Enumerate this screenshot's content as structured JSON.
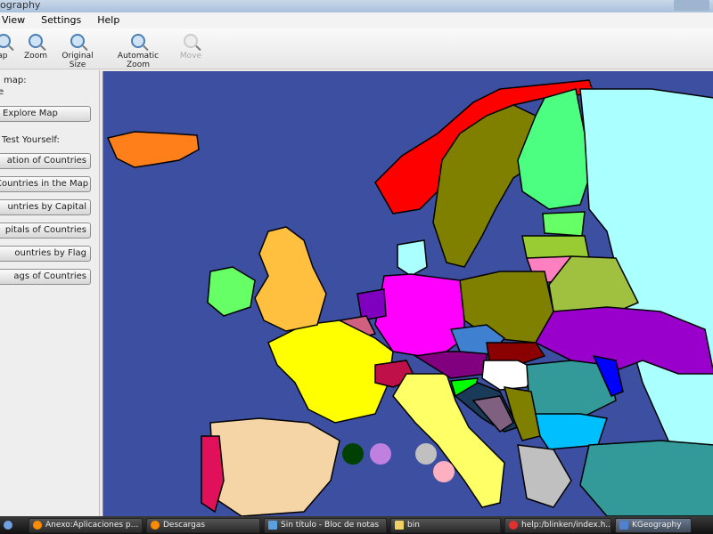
{
  "window": {
    "title": "ography"
  },
  "menu": {
    "items": [
      "View",
      "Settings",
      "Help"
    ]
  },
  "toolbar": {
    "items": [
      {
        "label": "Map",
        "icon": "map-icon"
      },
      {
        "label": "Zoom",
        "icon": "zoom-in-icon"
      },
      {
        "label": "Original Size",
        "icon": "zoom-original-icon"
      },
      {
        "label": "Automatic Zoom",
        "icon": "zoom-fit-icon"
      },
      {
        "label": "Move",
        "icon": "move-icon",
        "disabled": true
      }
    ]
  },
  "sidebar": {
    "map_label": "map:",
    "map_name": "e",
    "explore_button": "Explore Map",
    "test_label": "Test Yourself:",
    "tests": [
      "ation of Countries",
      "Countries in the Map",
      "untries by Capital",
      "pitals of Countries",
      "ountries by Flag",
      "ags of Countries"
    ]
  },
  "map": {
    "background": "#3d4fa0",
    "countries": [
      {
        "name": "iceland",
        "color": "#ff7f1a"
      },
      {
        "name": "norway",
        "color": "#ff0000"
      },
      {
        "name": "sweden",
        "color": "#808000"
      },
      {
        "name": "finland",
        "color": "#4cff80"
      },
      {
        "name": "russia",
        "color": "#aaffff"
      },
      {
        "name": "estonia",
        "color": "#66ff66"
      },
      {
        "name": "latvia",
        "color": "#99cc33"
      },
      {
        "name": "lithuania",
        "color": "#a0b040"
      },
      {
        "name": "kaliningrad",
        "color": "#ff80c0"
      },
      {
        "name": "belarus",
        "color": "#a0c040"
      },
      {
        "name": "ukraine",
        "color": "#9900cc"
      },
      {
        "name": "poland",
        "color": "#808000"
      },
      {
        "name": "germany",
        "color": "#ff00ff"
      },
      {
        "name": "denmark",
        "color": "#aaffff"
      },
      {
        "name": "netherlands",
        "color": "#8000c0"
      },
      {
        "name": "belgium",
        "color": "#d06080"
      },
      {
        "name": "france",
        "color": "#ffff00"
      },
      {
        "name": "uk",
        "color": "#ffc040"
      },
      {
        "name": "ireland",
        "color": "#66ff66"
      },
      {
        "name": "spain",
        "color": "#f5d5a5"
      },
      {
        "name": "portugal",
        "color": "#e0105a"
      },
      {
        "name": "switzerland",
        "color": "#c0104a"
      },
      {
        "name": "italy",
        "color": "#ffff66"
      },
      {
        "name": "austria",
        "color": "#800080"
      },
      {
        "name": "czech",
        "color": "#4080d0"
      },
      {
        "name": "slovakia",
        "color": "#8b0000"
      },
      {
        "name": "hungary",
        "color": "#ffffff"
      },
      {
        "name": "romania",
        "color": "#339999"
      },
      {
        "name": "moldova",
        "color": "#0000ff"
      },
      {
        "name": "slovenia",
        "color": "#00ff00"
      },
      {
        "name": "croatia",
        "color": "#1a3a5a"
      },
      {
        "name": "bosnia",
        "color": "#806080"
      },
      {
        "name": "serbia",
        "color": "#808000"
      },
      {
        "name": "bulgaria",
        "color": "#00bfff"
      },
      {
        "name": "greece",
        "color": "#c0c0c0"
      },
      {
        "name": "turkey",
        "color": "#339999"
      }
    ],
    "markers": [
      {
        "color": "#004000"
      },
      {
        "color": "#c080e0"
      },
      {
        "color": "#c0c0c0"
      },
      {
        "color": "#ffb0c0"
      }
    ]
  },
  "taskbar": {
    "items": [
      {
        "label": "Anexo:Aplicaciones p...",
        "color": "#ff8c00"
      },
      {
        "label": "Descargas",
        "color": "#ff8c00"
      },
      {
        "label": "Sin título - Bloc de notas",
        "color": "#5aa0e0"
      },
      {
        "label": "bin",
        "color": "#f0d060"
      },
      {
        "label": "help:/blinken/index.h...",
        "color": "#e03030"
      },
      {
        "label": "KGeography",
        "color": "#5080d0",
        "active": true
      }
    ]
  }
}
